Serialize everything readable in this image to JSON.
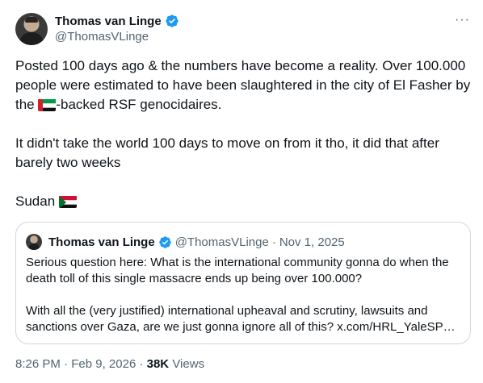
{
  "author": {
    "name": "Thomas van Linge",
    "handle": "@ThomasVLinge"
  },
  "more_label": "···",
  "post": {
    "line1_before_flag": "Posted 100 days ago & the numbers have become a reality. Over 100.000 people were estimated to have been slaughtered in the city of El Fasher by the ",
    "line1_after_flag": "-backed RSF genocidaires.",
    "line1_flag": "uae-flag-icon",
    "paragraph2": "It didn't take the world 100 days to move on from it tho, it did that after barely two weeks",
    "paragraph3": "Sudan ",
    "paragraph3_flag": "sudan-flag-icon"
  },
  "quote": {
    "name": "Thomas van Linge",
    "handle": "@ThomasVLinge",
    "separator": "·",
    "date": "Nov 1, 2025",
    "paragraph1": "Serious question here: What is the international community gonna do when the death toll of this single massacre ends up being over 100.000?",
    "paragraph2": "With all the (very justified) international upheaval and scrutiny, lawsuits and sanctions over Gaza, are we just gonna ignore all of this? x.com/HRL_YaleSP…"
  },
  "footer": {
    "time": "8:26 PM",
    "separator": "·",
    "date": "Feb 9, 2026",
    "views_count": "38K",
    "views_label": "Views"
  },
  "colors": {
    "verified": "#1d9bf0",
    "secondary_text": "#536471",
    "border": "#cfd9de"
  }
}
